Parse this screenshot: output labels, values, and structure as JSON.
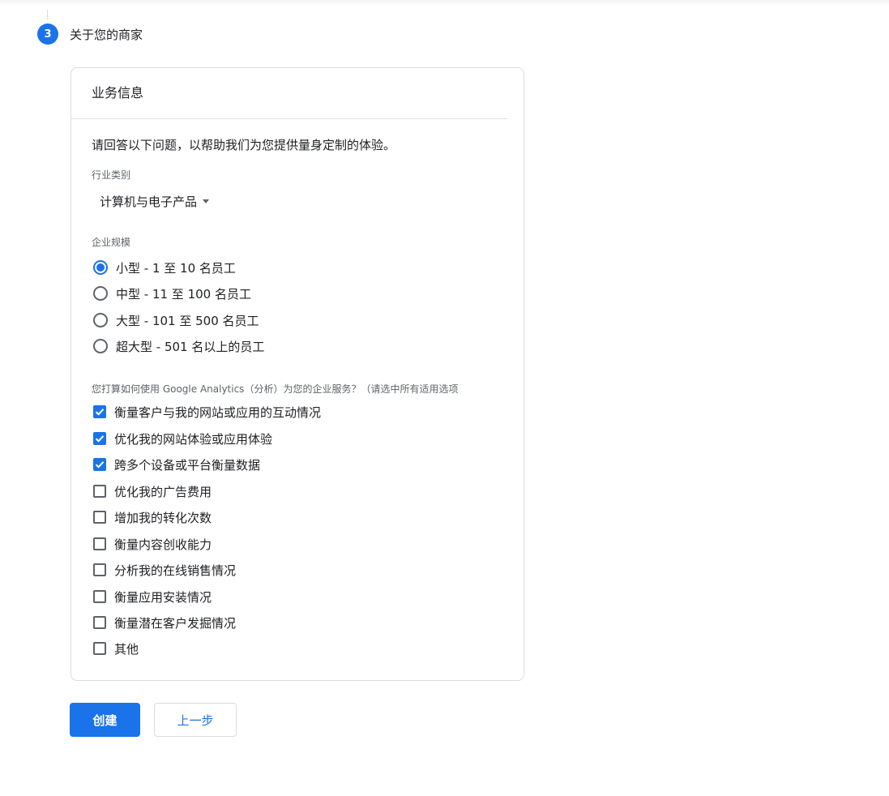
{
  "step": {
    "number": "3",
    "title": "关于您的商家"
  },
  "card": {
    "title": "业务信息",
    "intro": "请回答以下问题，以帮助我们为您提供量身定制的体验。"
  },
  "industry": {
    "label": "行业类别",
    "selected": "计算机与电子产品"
  },
  "size": {
    "label": "企业规模",
    "options": [
      {
        "label": "小型 - 1 至 10 名员工",
        "checked": true
      },
      {
        "label": "中型 - 11 至 100 名员工",
        "checked": false
      },
      {
        "label": "大型 - 101 至 500 名员工",
        "checked": false
      },
      {
        "label": "超大型 - 501 名以上的员工",
        "checked": false
      }
    ]
  },
  "usage": {
    "label": "您打算如何使用 Google Analytics（分析）为您的企业服务？（请选中所有适用选项",
    "options": [
      {
        "label": "衡量客户与我的网站或应用的互动情况",
        "checked": true
      },
      {
        "label": "优化我的网站体验或应用体验",
        "checked": true
      },
      {
        "label": "跨多个设备或平台衡量数据",
        "checked": true
      },
      {
        "label": "优化我的广告费用",
        "checked": false
      },
      {
        "label": "增加我的转化次数",
        "checked": false
      },
      {
        "label": "衡量内容创收能力",
        "checked": false
      },
      {
        "label": "分析我的在线销售情况",
        "checked": false
      },
      {
        "label": "衡量应用安装情况",
        "checked": false
      },
      {
        "label": "衡量潜在客户发掘情况",
        "checked": false
      },
      {
        "label": "其他",
        "checked": false
      }
    ]
  },
  "buttons": {
    "create": "创建",
    "back": "上一步"
  },
  "colors": {
    "accent": "#1a73e8",
    "border": "#dadce0",
    "text": "#202124",
    "muted": "#5f6368"
  }
}
